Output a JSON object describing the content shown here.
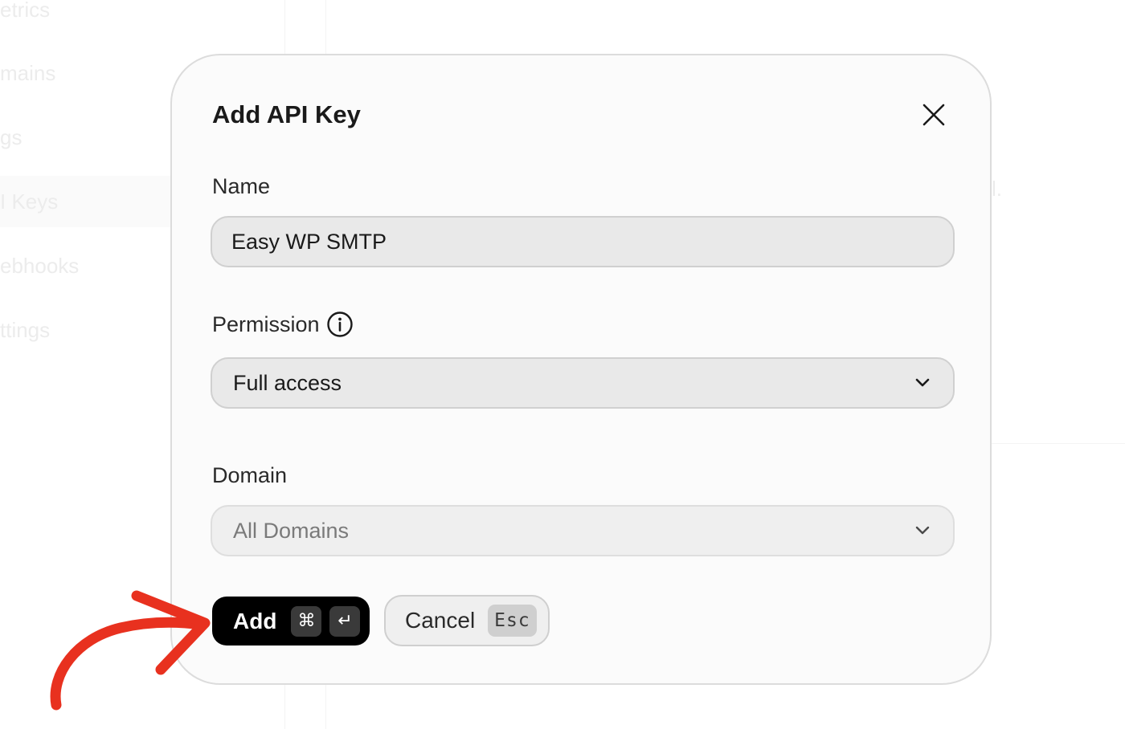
{
  "background": {
    "sidebar_items": [
      {
        "label": "etrics"
      },
      {
        "label": "mains"
      },
      {
        "label": "gs"
      },
      {
        "label": "I Keys"
      },
      {
        "label": "ebhooks"
      },
      {
        "label": "ttings"
      }
    ],
    "right_fragment": "l."
  },
  "modal": {
    "title": "Add API Key",
    "close_icon": "close-icon",
    "name": {
      "label": "Name",
      "value": "Easy WP SMTP"
    },
    "permission": {
      "label": "Permission",
      "info_icon": "info-icon",
      "selected": "Full access",
      "icon": "chevron-down-icon"
    },
    "domain": {
      "label": "Domain",
      "selected": "All Domains",
      "icon": "chevron-down-icon",
      "disabled": true
    },
    "add_button": {
      "label": "Add",
      "kbd_modifier": "⌘",
      "kbd_enter": "↵"
    },
    "cancel_button": {
      "label": "Cancel",
      "kbd": "Esc"
    }
  },
  "annotation": {
    "arrow_icon": "red-arrow-icon",
    "color": "#e8311f"
  },
  "colors": {
    "primary_button": "#000000",
    "modal_background": "#fbfbfb",
    "input_background": "#e9e9e9"
  }
}
